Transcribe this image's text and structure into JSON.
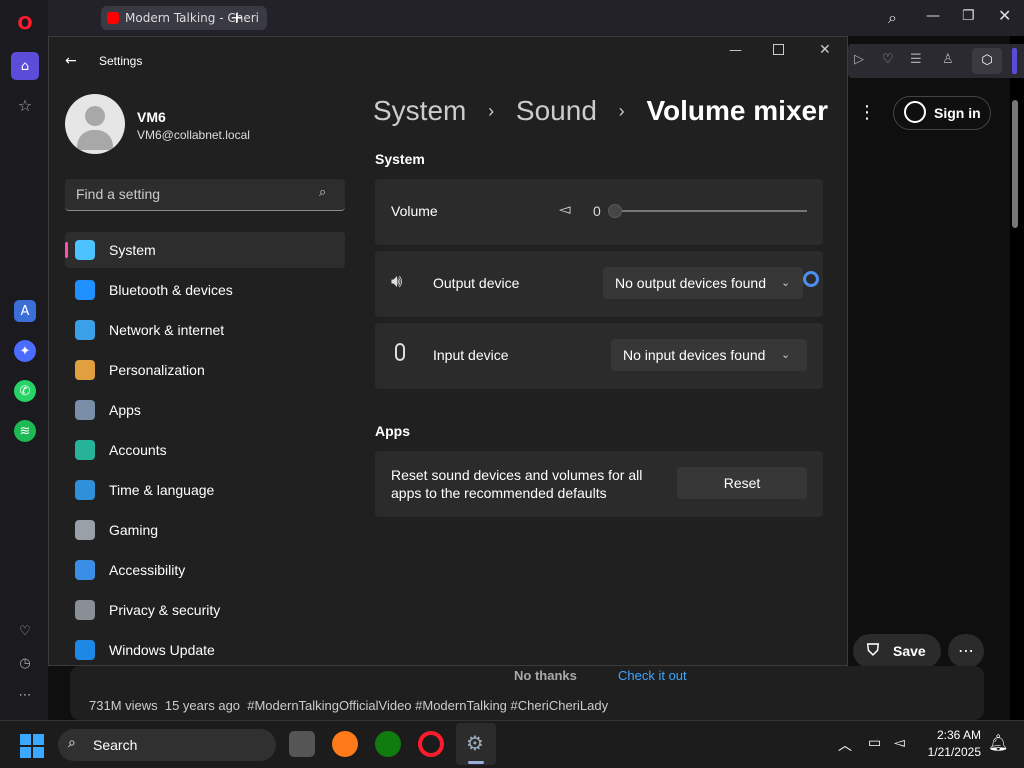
{
  "opera": {
    "tab_title": "Modern Talking - Cheri",
    "sign_in": "Sign in",
    "save": "Save",
    "no_thanks": "No thanks",
    "check_it_out": "Check it out",
    "video_meta": "731M views  15 years ago  #ModernTalkingOfficialVideo #ModernTalking #CheriCheriLady"
  },
  "settings": {
    "title": "Settings",
    "user": {
      "name": "VM6",
      "email": "VM6@collabnet.local"
    },
    "search_placeholder": "Find a setting",
    "nav": [
      {
        "label": "System",
        "color": "#4cc2ff"
      },
      {
        "label": "Bluetooth & devices",
        "color": "#1e90ff"
      },
      {
        "label": "Network & internet",
        "color": "#3aa0e8"
      },
      {
        "label": "Personalization",
        "color": "#e0a040"
      },
      {
        "label": "Apps",
        "color": "#7a8ea8"
      },
      {
        "label": "Accounts",
        "color": "#27b39a"
      },
      {
        "label": "Time & language",
        "color": "#2f8fd8"
      },
      {
        "label": "Gaming",
        "color": "#9aa0a8"
      },
      {
        "label": "Accessibility",
        "color": "#3a8ee6"
      },
      {
        "label": "Privacy & security",
        "color": "#8a8f96"
      },
      {
        "label": "Windows Update",
        "color": "#1e88e5"
      }
    ],
    "breadcrumb": {
      "a": "System",
      "b": "Sound",
      "c": "Volume mixer"
    },
    "section_system": "System",
    "volume_label": "Volume",
    "volume_value": "0",
    "output_label": "Output device",
    "output_value": "No output devices found",
    "input_label": "Input device",
    "input_value": "No input devices found",
    "section_apps": "Apps",
    "reset_text_1": "Reset sound devices and volumes for all",
    "reset_text_2": "apps to the recommended defaults",
    "reset_button": "Reset"
  },
  "taskbar": {
    "search": "Search",
    "time": "2:36 AM",
    "date": "1/21/2025"
  }
}
